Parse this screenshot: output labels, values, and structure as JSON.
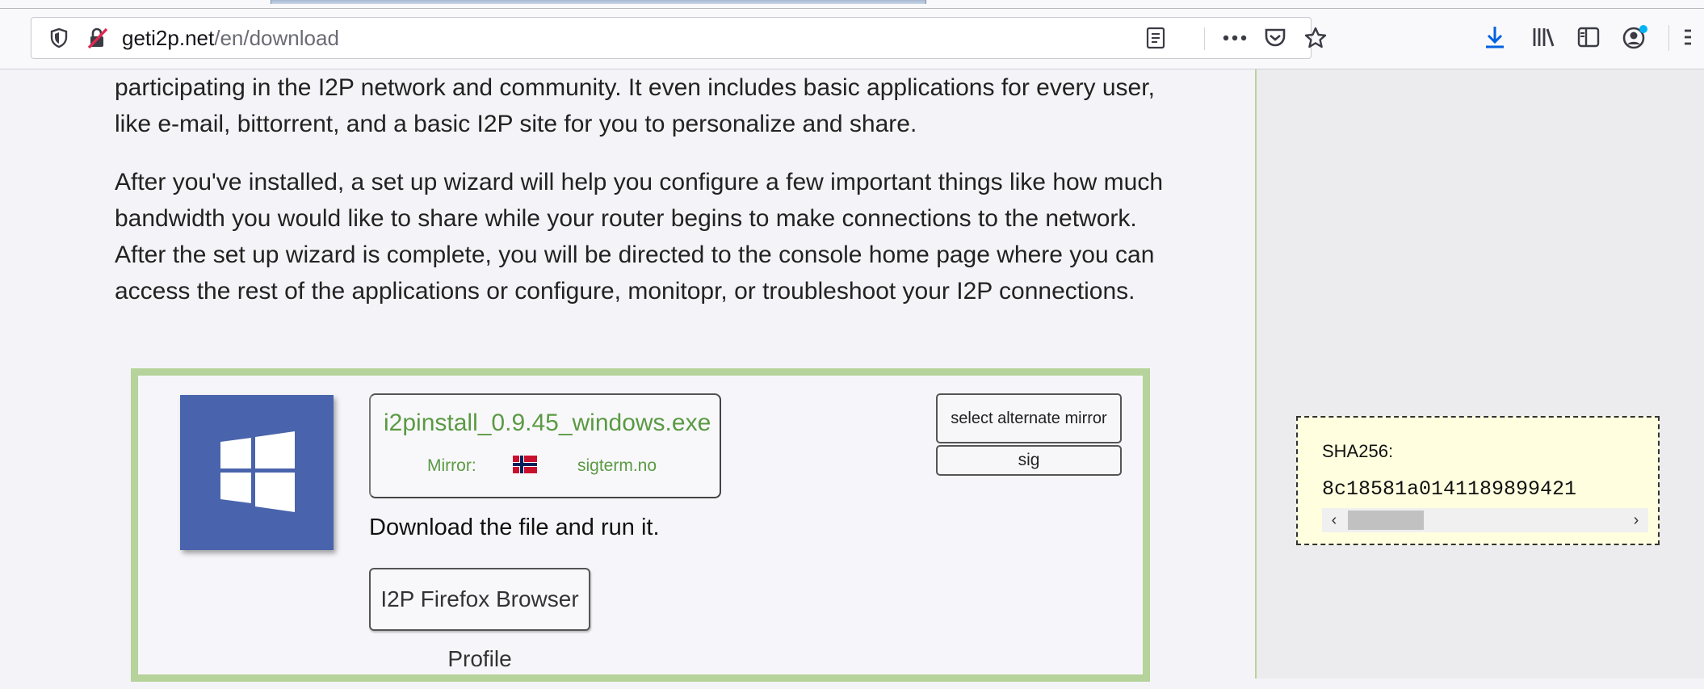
{
  "browser": {
    "url_domain": "geti2p.net",
    "url_path": "/en/download",
    "icons": {
      "shield": "tracking-protection-shield-icon",
      "insecure": "insecure-lock-icon",
      "reader": "reader-view-icon",
      "more": "page-actions-ellipsis-icon",
      "pocket": "pocket-icon",
      "star": "bookmark-star-icon",
      "download": "download-arrow-icon",
      "library": "library-icon",
      "sidebar": "sidebar-toggle-icon",
      "account": "account-icon",
      "menu": "hamburger-menu-icon"
    },
    "accent": "#0060df"
  },
  "content": {
    "para1": "participating in the I2P network and community. It even includes basic applications for every user, like e-mail, bittorrent, and a basic I2P site for you to personalize and share.",
    "para2": "After you've installed, a set up wizard will help you configure a few important things like how much bandwidth you would like to share while your router begins to make connections to the network. After the set up wizard is complete, you will be directed to the console home page where you can access the rest of the applications or configure, monitopr, or troubleshoot your I2P connections."
  },
  "download": {
    "os_icon": "windows-logo-icon",
    "file_name": "i2pinstall_0.9.45_windows.exe",
    "mirror_label": "Mirror:",
    "mirror_flag": "norway-flag-icon",
    "mirror_host": "sigterm.no",
    "alt_mirror_label": "select alternate mirror",
    "sig_label": "sig",
    "instruction": "Download the file and run it.",
    "firefox_profile_label": "I2P Firefox Browser Profile",
    "border_color": "#b5d39a",
    "link_color": "#5a9a42"
  },
  "sha": {
    "label": "SHA256:",
    "value": "8c18581a0141189899421",
    "scroll_left": "‹",
    "scroll_right": "›"
  }
}
